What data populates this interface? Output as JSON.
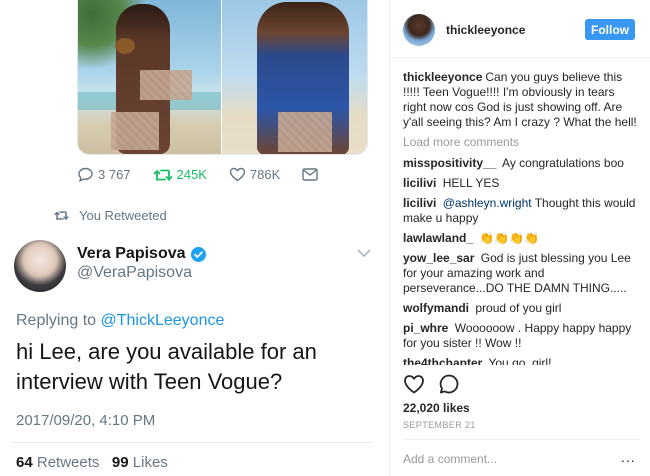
{
  "twitter": {
    "actions": {
      "replies": "3 767",
      "retweets": "245K",
      "likes": "786K"
    },
    "retweeted_label": "You Retweeted",
    "tweet": {
      "name": "Vera Papisova",
      "handle": "@VeraPapisova",
      "replying_prefix": "Replying to",
      "replying_mention": "@ThickLeeyonce",
      "text": "hi Lee, are you available for an interview with Teen Vogue?",
      "timestamp": "2017/09/20, 4:10 PM",
      "retweets_count": "64",
      "retweets_label": "Retweets",
      "likes_count": "99",
      "likes_label": "Likes"
    },
    "colors": {
      "retweet_green": "#17bf63",
      "link_blue": "#1b95e0",
      "verified_blue": "#1da1f2"
    }
  },
  "instagram": {
    "username": "thickleeyonce",
    "follow_label": "Follow",
    "caption_user": "thickleeyonce",
    "caption": "Can you guys believe this !!!!! Teen Vogue!!!! I'm obviously in tears right now cos God is just showing off. Are y'all seeing this? Am I crazy ? What the hell!",
    "load_more": "Load more comments",
    "comments": [
      {
        "user": "misspositivity__",
        "text": "Ay congratulations boo"
      },
      {
        "user": "licilivi",
        "text": "HELL YES"
      },
      {
        "user": "licilivi",
        "mention": "@ashleyn.wright",
        "text": "Thought this would make u happy"
      },
      {
        "user": "lawlawland_",
        "text": "👏👏👏👏"
      },
      {
        "user": "yow_lee_sar",
        "text": "God is just blessing you Lee for your amazing work and perseverance...DO THE DAMN THING....."
      },
      {
        "user": "wolfymandi",
        "text": "proud of you girl"
      },
      {
        "user": "pi_whre",
        "text": "Woooooow . Happy happy happy for you sister !! Wow !!"
      },
      {
        "user": "the4thchapter",
        "text": "You go, girl!"
      }
    ],
    "likes": "22,020 likes",
    "date": "SEPTEMBER 21",
    "add_comment_placeholder": "Add a comment...",
    "more_label": "...",
    "colors": {
      "follow_blue": "#3897f0"
    }
  }
}
